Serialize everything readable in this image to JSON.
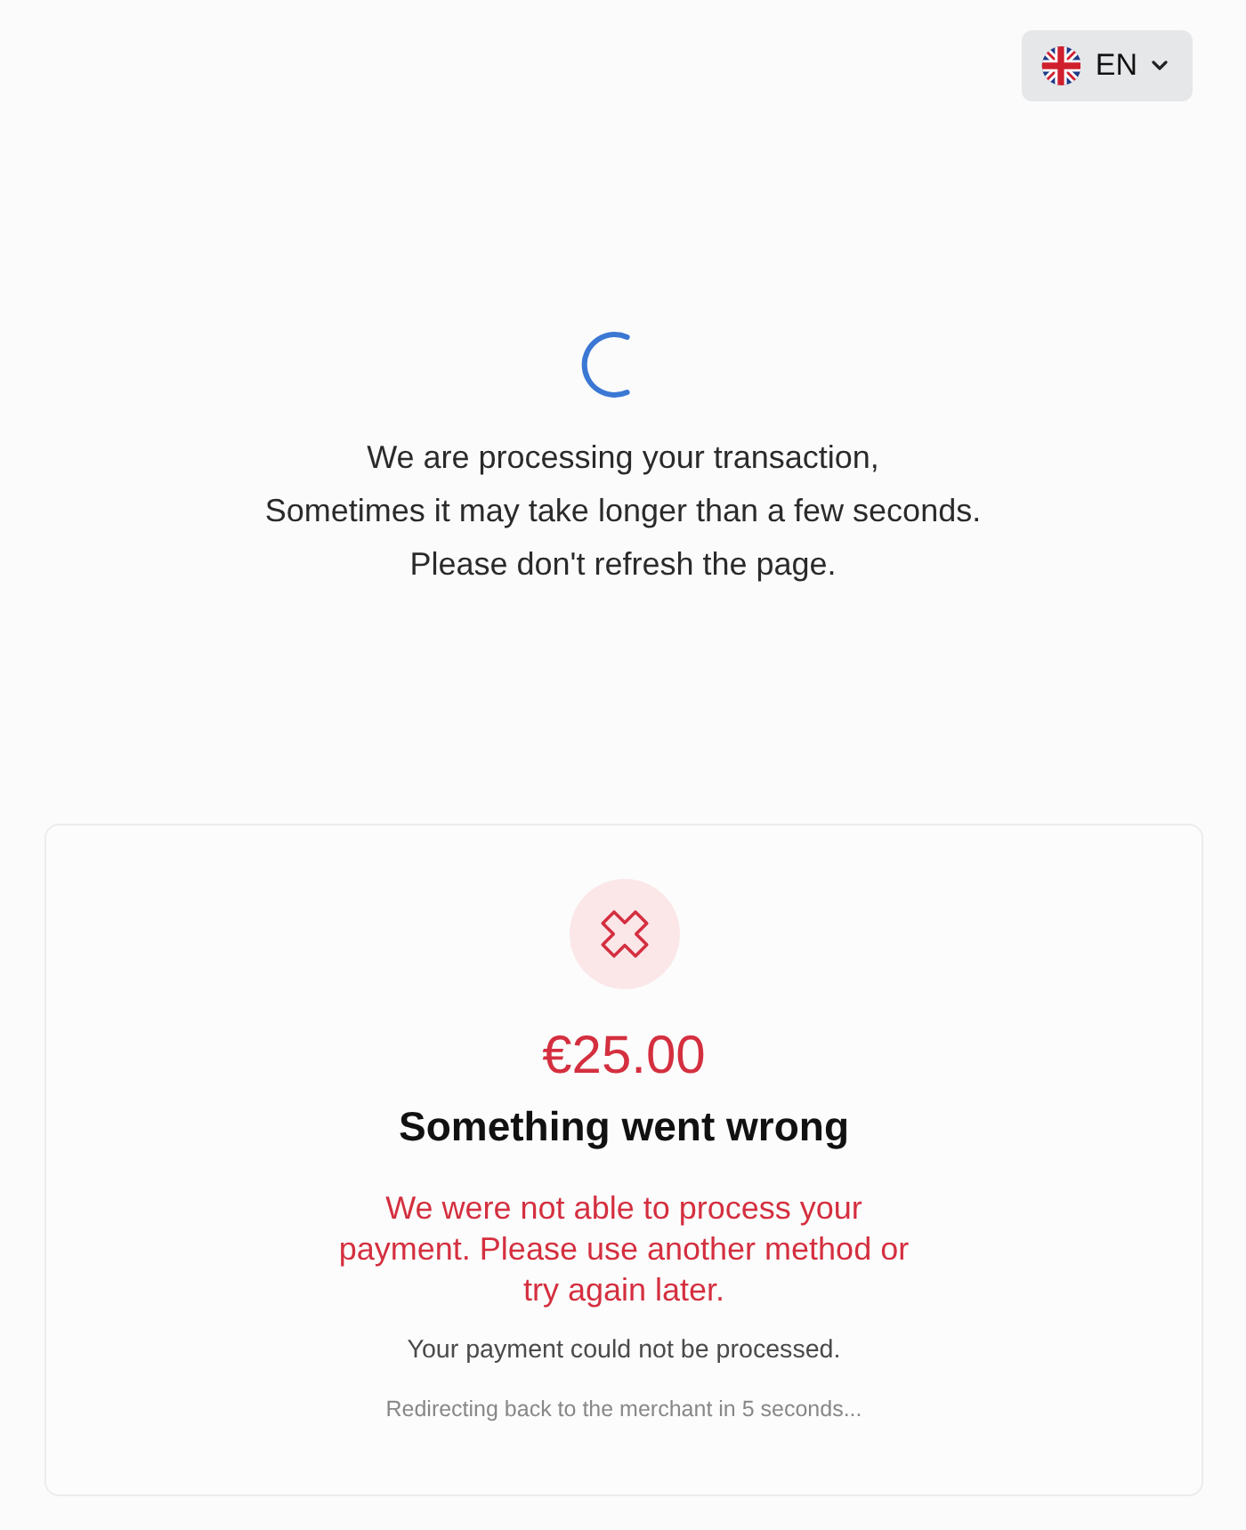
{
  "language_selector": {
    "label": "EN"
  },
  "processing": {
    "lines": [
      "We are processing your transaction,",
      "Sometimes it may take longer than a few seconds.",
      "Please don't refresh the page."
    ]
  },
  "result": {
    "failed": true,
    "amount": "€25.00",
    "title": "Something went wrong",
    "error_message": "We were not able to process your payment. Please use another method or try again later.",
    "detail": "Your payment could not be processed.",
    "redirect_notice": "Redirecting back to the merchant in 5 seconds..."
  }
}
